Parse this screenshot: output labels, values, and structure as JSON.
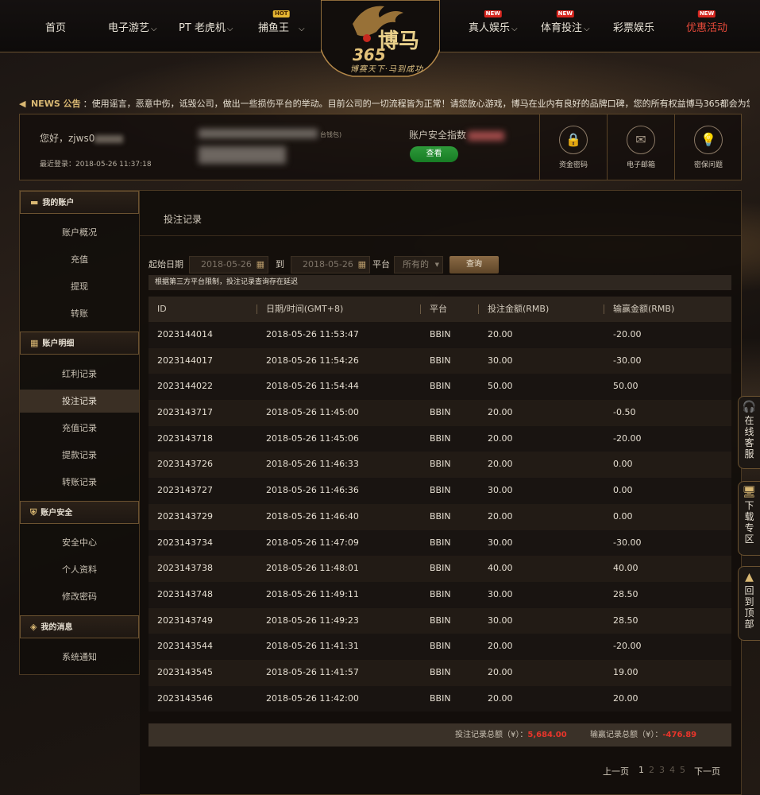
{
  "nav": {
    "items": [
      {
        "label": "首页",
        "chevron": false,
        "badge": ""
      },
      {
        "label": "电子游艺",
        "chevron": true,
        "badge": ""
      },
      {
        "label": "PT 老虎机",
        "chevron": true,
        "badge": ""
      },
      {
        "label": "捕鱼王",
        "chevron": true,
        "badge": "HOT"
      },
      {
        "label": "真人娱乐",
        "chevron": true,
        "badge": "NEW"
      },
      {
        "label": "体育投注",
        "chevron": true,
        "badge": "NEW"
      },
      {
        "label": "彩票娱乐",
        "chevron": false,
        "badge": ""
      },
      {
        "label": "优惠活动",
        "chevron": false,
        "badge": "NEW"
      }
    ],
    "logo_main": "博马",
    "logo_num": "365",
    "logo_slogan": "博赛天下·马到成功"
  },
  "news": {
    "label": "NEWS 公告",
    "text": "：使用谣言，恶意中伤，诋毁公司，做出一些损伤平台的举动。目前公司的一切流程皆为正常！请您放心游戏，博马在业内有良好的品牌口碑，您的所有权益博马365都会为您保障"
  },
  "account": {
    "greeting": "您好，zjws0",
    "last_login": "最近登录：2018-05-26 11:37:18",
    "wallet_hint": "台钱包)",
    "security_label": "账户安全指数",
    "check_button": "查看",
    "tiles": [
      {
        "label": "资金密码",
        "icon": "lock-icon",
        "glyph": "🔒"
      },
      {
        "label": "电子邮箱",
        "icon": "mail-icon",
        "glyph": "✉"
      },
      {
        "label": "密保问题",
        "icon": "bulb-icon",
        "glyph": "💡"
      }
    ]
  },
  "sidebar": {
    "sections": [
      {
        "title": "我的账户",
        "icon": "wallet-icon",
        "glyph": "▬",
        "links": [
          "账户概况",
          "充值",
          "提现",
          "转账"
        ]
      },
      {
        "title": "账户明细",
        "icon": "calculator-icon",
        "glyph": "▦",
        "links": [
          "红利记录",
          "投注记录",
          "充值记录",
          "提款记录",
          "转账记录"
        ]
      },
      {
        "title": "账户安全",
        "icon": "shield-icon",
        "glyph": "⛨",
        "links": [
          "安全中心",
          "个人资料",
          "修改密码"
        ]
      },
      {
        "title": "我的消息",
        "icon": "message-icon",
        "glyph": "◈",
        "links": [
          "系统通知"
        ]
      }
    ],
    "active": "投注记录"
  },
  "main": {
    "title": "投注记录",
    "filter": {
      "start_label": "起始日期",
      "start_value": "2018-05-26",
      "to_label": "到",
      "end_value": "2018-05-26",
      "platform_label": "平台",
      "platform_value": "所有的",
      "query_button": "查询"
    },
    "notice": "根据第三方平台限制，投注记录查询存在延迟",
    "columns": [
      "ID",
      "日期/时间(GMT+8)",
      "平台",
      "投注金额(RMB)",
      "输赢金额(RMB)"
    ],
    "rows": [
      [
        "2023144014",
        "2018-05-26 11:53:47",
        "BBIN",
        "20.00",
        "-20.00"
      ],
      [
        "2023144017",
        "2018-05-26 11:54:26",
        "BBIN",
        "30.00",
        "-30.00"
      ],
      [
        "2023144022",
        "2018-05-26 11:54:44",
        "BBIN",
        "50.00",
        "50.00"
      ],
      [
        "2023143717",
        "2018-05-26 11:45:00",
        "BBIN",
        "20.00",
        "-0.50"
      ],
      [
        "2023143718",
        "2018-05-26 11:45:06",
        "BBIN",
        "20.00",
        "-20.00"
      ],
      [
        "2023143726",
        "2018-05-26 11:46:33",
        "BBIN",
        "20.00",
        "0.00"
      ],
      [
        "2023143727",
        "2018-05-26 11:46:36",
        "BBIN",
        "30.00",
        "0.00"
      ],
      [
        "2023143729",
        "2018-05-26 11:46:40",
        "BBIN",
        "20.00",
        "0.00"
      ],
      [
        "2023143734",
        "2018-05-26 11:47:09",
        "BBIN",
        "30.00",
        "-30.00"
      ],
      [
        "2023143738",
        "2018-05-26 11:48:01",
        "BBIN",
        "40.00",
        "40.00"
      ],
      [
        "2023143748",
        "2018-05-26 11:49:11",
        "BBIN",
        "30.00",
        "28.50"
      ],
      [
        "2023143749",
        "2018-05-26 11:49:23",
        "BBIN",
        "30.00",
        "28.50"
      ],
      [
        "2023143544",
        "2018-05-26 11:41:31",
        "BBIN",
        "20.00",
        "-20.00"
      ],
      [
        "2023143545",
        "2018-05-26 11:41:57",
        "BBIN",
        "20.00",
        "19.00"
      ],
      [
        "2023143546",
        "2018-05-26 11:42:00",
        "BBIN",
        "20.00",
        "20.00"
      ]
    ],
    "summary": {
      "bet_total_label": "投注记录总额（¥）：",
      "bet_total": "5,684.00",
      "win_total_label": "输赢记录总额（¥）：",
      "win_total": "-476.89"
    },
    "pager": {
      "prev": "上一页",
      "pages": [
        "1",
        "2",
        "3",
        "4",
        "5"
      ],
      "current": "1",
      "next": "下一页"
    }
  },
  "float": [
    {
      "label": "在线客服",
      "icon": "headset-icon",
      "glyph": "🎧"
    },
    {
      "label": "下载专区",
      "icon": "monitor-icon",
      "glyph": "🖥"
    },
    {
      "label": "回到顶部",
      "icon": "rocket-icon",
      "glyph": "▲"
    }
  ],
  "colors": {
    "accent_gold": "#d9b873",
    "alert_red": "#e8352b",
    "check_green": "#2e9a3a"
  }
}
